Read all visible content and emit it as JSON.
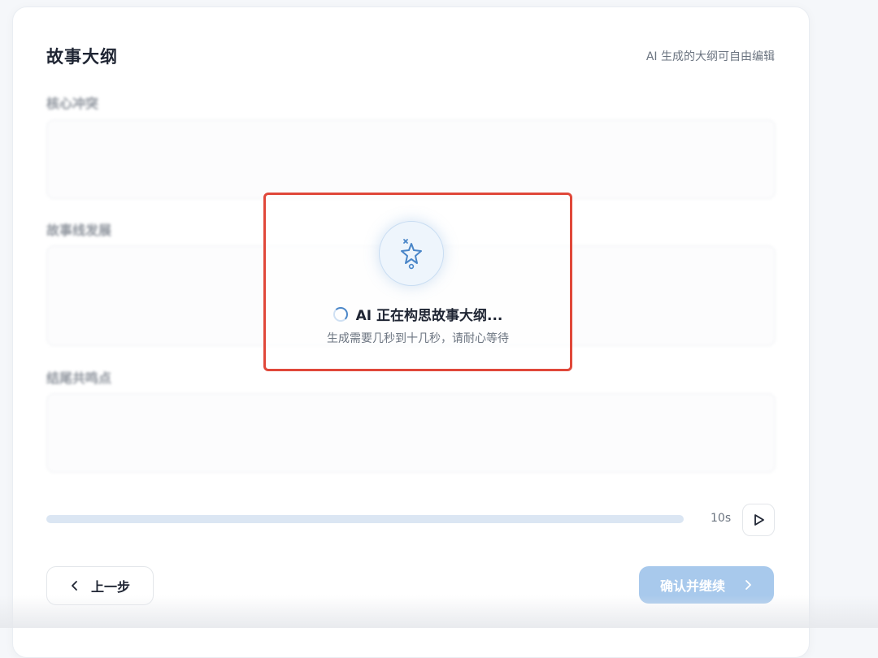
{
  "header": {
    "title": "故事大纲",
    "hint": "AI 生成的大纲可自由编辑"
  },
  "fields": [
    {
      "label": "核心冲突",
      "value": ""
    },
    {
      "label": "故事线发展",
      "value": ""
    },
    {
      "label": "结尾共鸣点",
      "value": ""
    }
  ],
  "progress": {
    "fraction": 0,
    "time_label": "10s"
  },
  "loading": {
    "title": "AI 正在构思故事大纲...",
    "subtitle": "生成需要几秒到十几秒，请耐心等待",
    "border_color": "#e0483a"
  },
  "footer": {
    "back_label": "上一步",
    "next_label": "确认并继续"
  },
  "colors": {
    "accent": "#4a86c8",
    "next_disabled": "#a8c9ec",
    "progress_track": "#dbe6f3"
  },
  "icons": [
    "sparkle-star-icon",
    "spinner-icon",
    "play-icon",
    "chevron-left-icon",
    "chevron-right-icon"
  ]
}
